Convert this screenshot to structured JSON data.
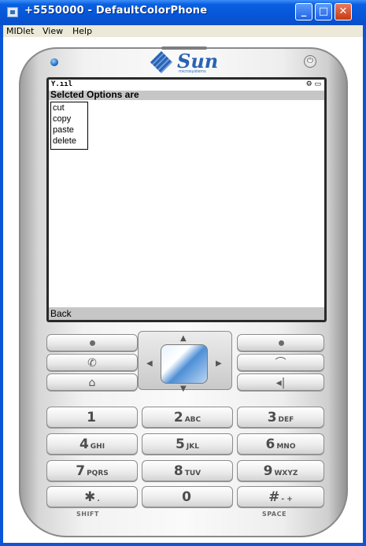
{
  "window": {
    "title": "+5550000 - DefaultColorPhone",
    "minimize_glyph": "_",
    "maximize_glyph": "□",
    "close_glyph": "✕"
  },
  "menubar": {
    "items": [
      "MIDlet",
      "View",
      "Help"
    ]
  },
  "phone": {
    "brand": "Sun",
    "brand_sub": "microsystems",
    "status": {
      "signal": "Ƴ.ııl",
      "battery": "⚙ ▭"
    },
    "screen": {
      "title": "Selcted Options are",
      "list": [
        "cut",
        "copy",
        "paste",
        "delete"
      ],
      "soft_left": "Back"
    },
    "keys": {
      "call": "✆",
      "end": "⌒",
      "home": "⌂",
      "clear": "◂|",
      "nav_up": "▲",
      "nav_down": "▼",
      "nav_left": "◀",
      "nav_right": "▶",
      "num": [
        {
          "n": "1",
          "l": ""
        },
        {
          "n": "2",
          "l": "ABC"
        },
        {
          "n": "3",
          "l": "DEF"
        },
        {
          "n": "4",
          "l": "GHI"
        },
        {
          "n": "5",
          "l": "JKL"
        },
        {
          "n": "6",
          "l": "MNO"
        },
        {
          "n": "7",
          "l": "PQRS"
        },
        {
          "n": "8",
          "l": "TUV"
        },
        {
          "n": "9",
          "l": "WXYZ"
        },
        {
          "n": "✱",
          "l": "."
        },
        {
          "n": "0",
          "l": ""
        },
        {
          "n": "#",
          "l": "- +"
        }
      ],
      "shift_label": "SHIFT",
      "space_label": "SPACE"
    }
  }
}
